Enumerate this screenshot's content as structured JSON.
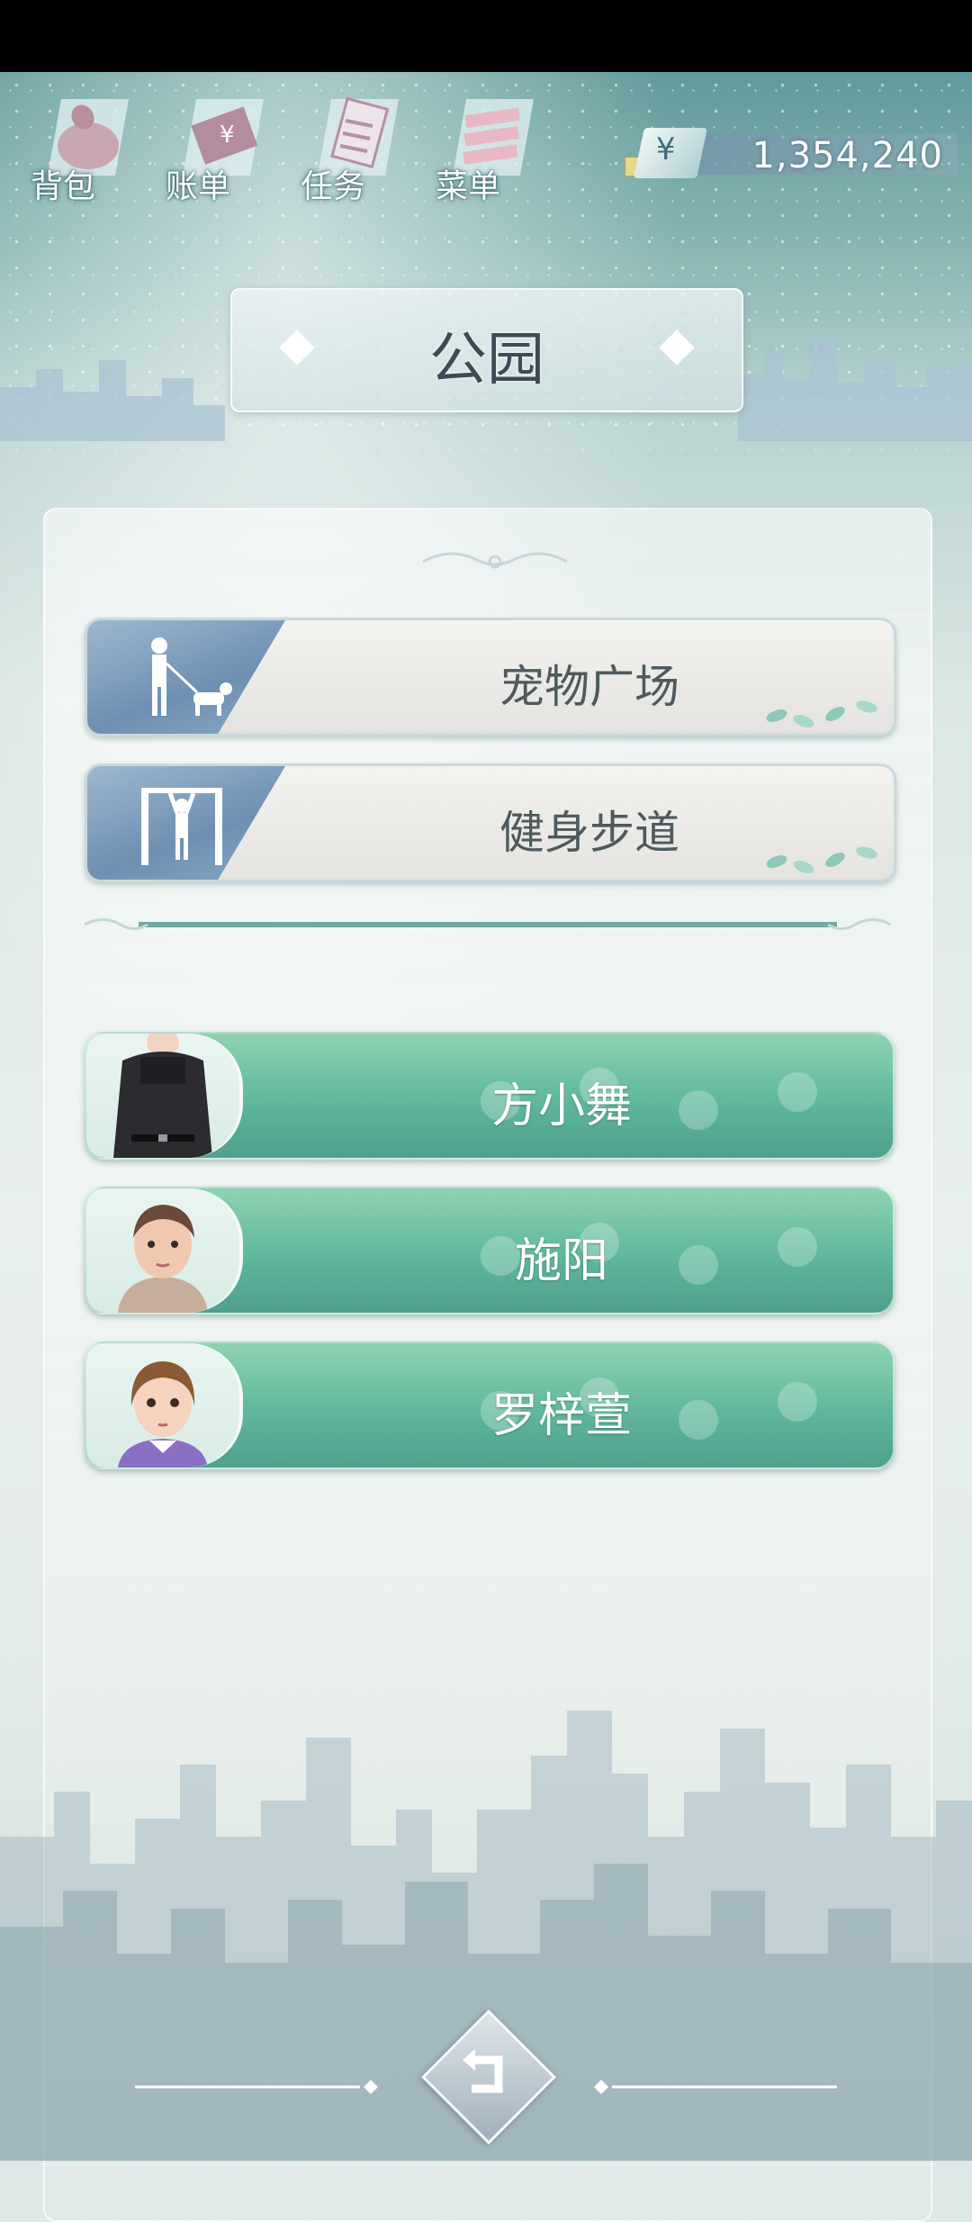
{
  "toolbar": {
    "items": [
      {
        "label": "背包",
        "icon": "bag-icon"
      },
      {
        "label": "账单",
        "icon": "bill-icon"
      },
      {
        "label": "任务",
        "icon": "task-icon"
      },
      {
        "label": "菜单",
        "icon": "menu-icon"
      }
    ]
  },
  "currency": {
    "symbol": "¥",
    "amount": "1,354,240"
  },
  "location": {
    "title": "公园"
  },
  "places": [
    {
      "label": "宠物广场",
      "icon": "dog-walker-icon"
    },
    {
      "label": "健身步道",
      "icon": "pullup-bar-icon"
    }
  ],
  "characters": [
    {
      "name": "方小舞",
      "avatar": "black-outfit-avatar"
    },
    {
      "name": "施阳",
      "avatar": "short-hair-avatar"
    },
    {
      "name": "罗梓萱",
      "avatar": "purple-collar-avatar"
    }
  ],
  "colors": {
    "npc_button": "#5fb79c",
    "place_button": "#e9e8e4",
    "place_icon_panel": "#7e9ebd",
    "title_text": "#3a4d57"
  }
}
